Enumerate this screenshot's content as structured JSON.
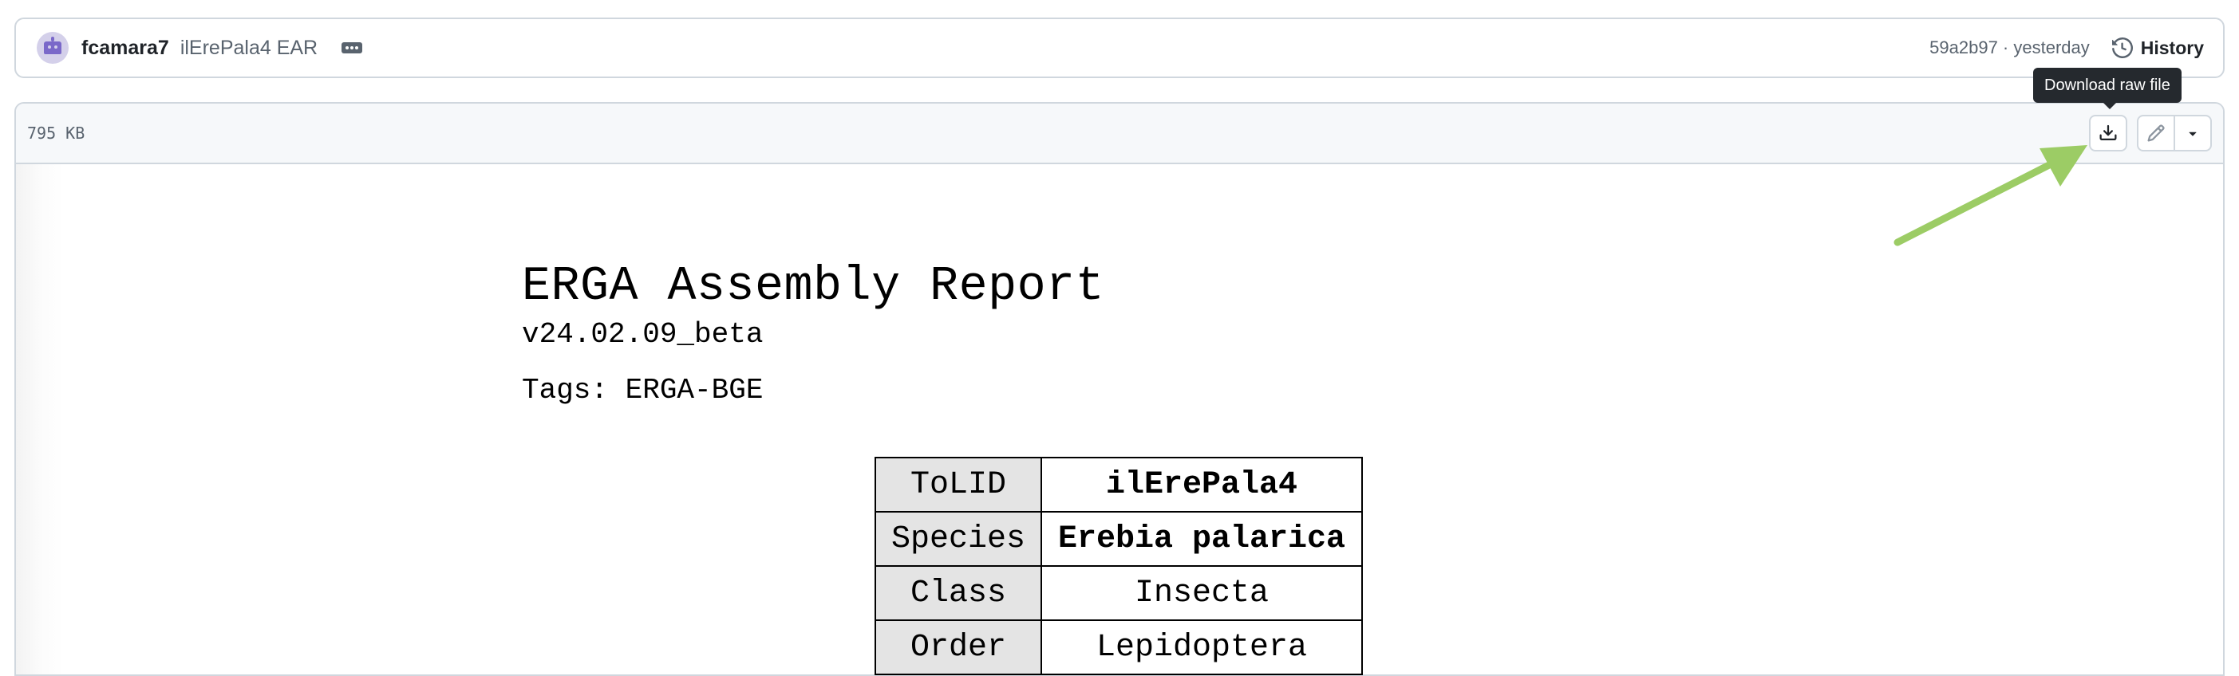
{
  "commit": {
    "author": "fcamara7",
    "message": "ilErePala4 EAR",
    "meta": "59a2b97 · yesterday",
    "history_label": "History"
  },
  "file": {
    "size": "795 KB",
    "tooltip": "Download raw file"
  },
  "report": {
    "title": "ERGA Assembly Report",
    "version": "v24.02.09_beta",
    "tags": "Tags: ERGA-BGE",
    "table": [
      {
        "key": "ToLID",
        "value": "ilErePala4",
        "bold": true
      },
      {
        "key": "Species",
        "value": "Erebia palarica",
        "bold": true
      },
      {
        "key": "Class",
        "value": "Insecta",
        "bold": false
      },
      {
        "key": "Order",
        "value": "Lepidoptera",
        "bold": false
      }
    ]
  },
  "colors": {
    "annotation_arrow": "#9ccc65",
    "tooltip_bg": "#25292e",
    "border": "#d0d7de"
  },
  "icons": [
    "bot-avatar-icon",
    "ellipsis-icon",
    "history-icon",
    "download-icon",
    "pencil-icon",
    "triangle-down-icon",
    "arrow-annotation"
  ]
}
